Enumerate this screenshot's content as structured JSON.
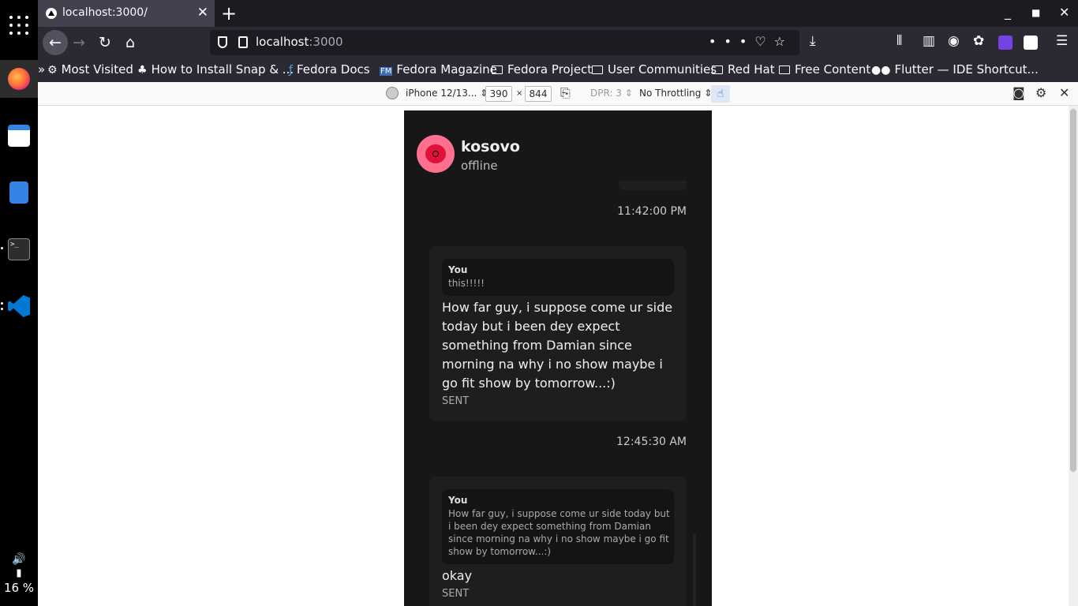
{
  "dock": {
    "battery": "16 %"
  },
  "browser": {
    "tab_title": "localhost:3000/",
    "url_host": "localhost",
    "url_port": ":3000",
    "bookmarks": [
      "Most Visited",
      "How to Install Snap & ...",
      "Fedora Docs",
      "Fedora Magazine",
      "Fedora Project",
      "User Communities",
      "Red Hat",
      "Free Content",
      "Flutter — IDE Shortcut..."
    ]
  },
  "rdm": {
    "device": "iPhone 12/13...",
    "width": "390",
    "times": "×",
    "height": "844",
    "dpr": "DPR: 3",
    "throttling": "No Throttling"
  },
  "chat": {
    "contact_name": "kosovo",
    "contact_status": "offline",
    "messages": [
      {
        "time": "11:42:00 PM",
        "quote_author": "You",
        "quote_text": "this!!!!!",
        "body": "How far guy, i suppose come ur side today but i been dey expect something from Damian since morning na why i no show maybe i go fit show by tomorrow...:)",
        "status": "SENT"
      },
      {
        "time": "12:45:30 AM",
        "quote_author": "You",
        "quote_text": "How far guy, i suppose come ur side today but i been dey expect something from Damian since morning na why i no show maybe i go fit show by tomorrow...:)",
        "body": "okay",
        "status": "SENT"
      }
    ]
  }
}
